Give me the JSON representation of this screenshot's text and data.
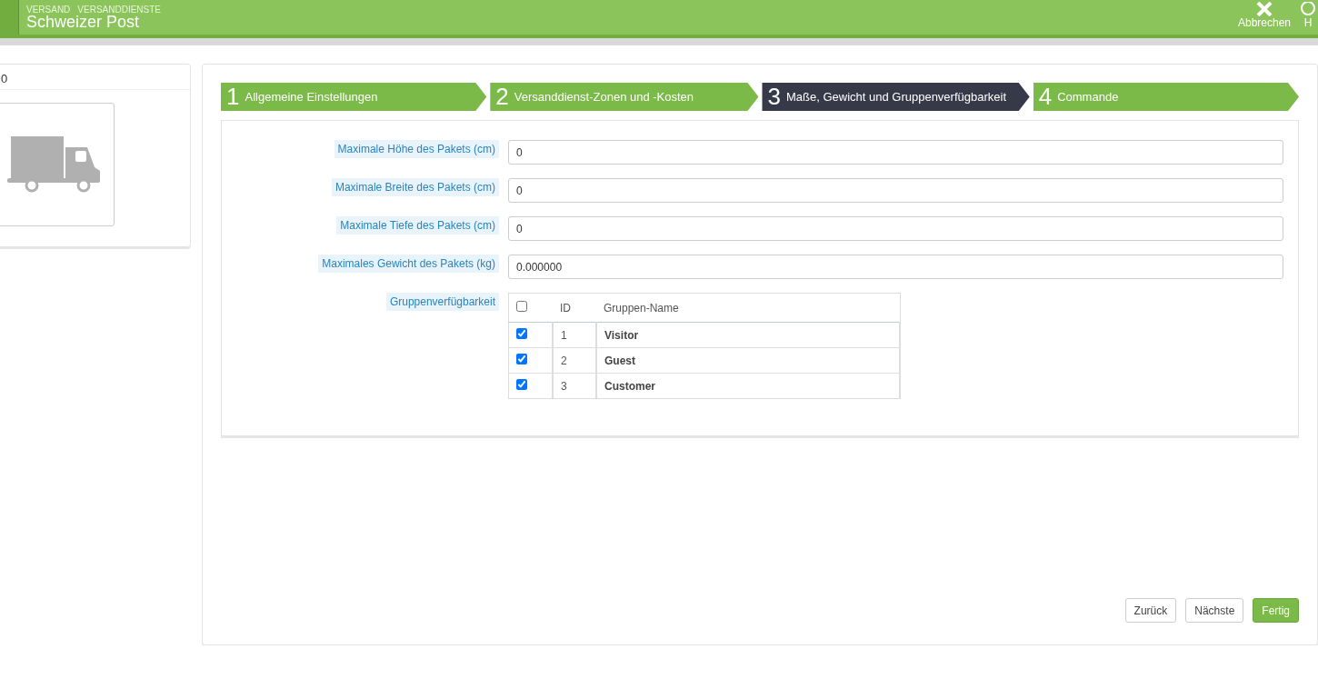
{
  "header": {
    "breadcrumb": [
      "VERSAND",
      "VERSANDDIENSTE"
    ],
    "title": "Schweizer Post",
    "actions": [
      {
        "kind": "cancel",
        "label": "Abbrechen"
      },
      {
        "kind": "help",
        "label": "H"
      }
    ]
  },
  "side_panel": {
    "heading": "0"
  },
  "steps": [
    {
      "number": "1",
      "label": "Allgemeine Einstellungen",
      "selected": false
    },
    {
      "number": "2",
      "label": "Versanddienst-Zonen und -Kosten",
      "selected": false
    },
    {
      "number": "3",
      "label": "Maße, Gewicht und Gruppenverfügbarkeit",
      "selected": true
    },
    {
      "number": "4",
      "label": "Commande",
      "selected": false
    }
  ],
  "fields": [
    {
      "label": "Maximale Höhe des Pakets (cm)",
      "value": "0"
    },
    {
      "label": "Maximale Breite des Pakets (cm)",
      "value": "0"
    },
    {
      "label": "Maximale Tiefe des Pakets (cm)",
      "value": "0"
    },
    {
      "label": "Maximales Gewicht des Pakets (kg)",
      "value": "0.000000"
    }
  ],
  "groups": {
    "label": "Gruppenverfügbarkeit",
    "all_checked": false,
    "columns": [
      "ID",
      "Gruppen-Name"
    ],
    "rows": [
      {
        "id": "1",
        "name": "Visitor",
        "checked": true
      },
      {
        "id": "2",
        "name": "Guest",
        "checked": true
      },
      {
        "id": "3",
        "name": "Customer",
        "checked": true
      }
    ]
  },
  "buttons": [
    {
      "label": "Zurück",
      "primary": false
    },
    {
      "label": "Nächste",
      "primary": false
    },
    {
      "label": "Fertig",
      "primary": true
    }
  ]
}
